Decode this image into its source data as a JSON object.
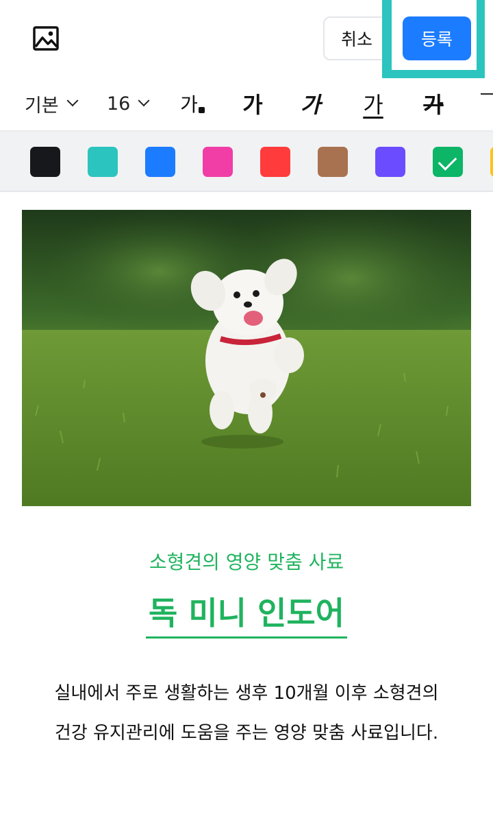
{
  "header": {
    "image_icon": "image-icon",
    "cancel_label": "취소",
    "register_label": "등록"
  },
  "toolbar": {
    "font_family": "기본",
    "font_size": "16",
    "styles": [
      {
        "name": "text-color",
        "label": "가"
      },
      {
        "name": "bold",
        "label": "가"
      },
      {
        "name": "italic",
        "label": "가"
      },
      {
        "name": "underline",
        "label": "가"
      },
      {
        "name": "strikethrough",
        "label": "가"
      }
    ]
  },
  "palette": {
    "colors": [
      "#17181c",
      "#2cc4be",
      "#1c7cff",
      "#f03ea6",
      "#ff3b3b",
      "#a87250",
      "#6b4dff",
      "#0db567",
      "#ffc21c"
    ],
    "selected_index": 7
  },
  "content": {
    "subtitle": "소형견의 영양 맞춤 사료",
    "title": "독 미니 인도어",
    "body_line1": "실내에서 주로 생활하는 생후 10개월 이후 소형견의",
    "body_line2": "건강 유지관리에 도움을 주는 영양 맞춤 사료입니다."
  }
}
